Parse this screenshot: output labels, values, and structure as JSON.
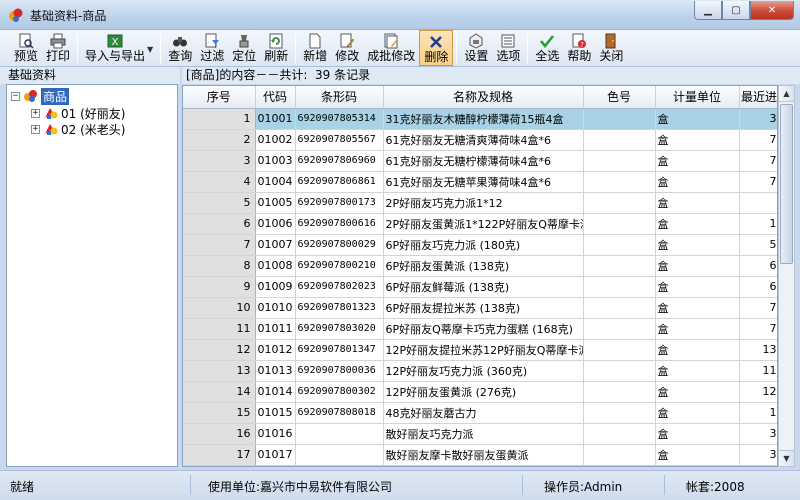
{
  "window": {
    "title": "基础资料-商品",
    "minimize": "0",
    "restore": "1",
    "close": "r"
  },
  "toolbar": {
    "preview": "预览",
    "print": "打印",
    "import_export": "导入与导出",
    "query": "查询",
    "filter": "过滤",
    "locate": "定位",
    "refresh": "刷新",
    "add": "新增",
    "modify": "修改",
    "batch_modify": "成批修改",
    "delete": "删除",
    "settings": "设置",
    "options": "选项",
    "select_all": "全选",
    "help": "帮助",
    "close": "关闭"
  },
  "left_pane": {
    "title": "基础资料",
    "root_toggle": "−",
    "root": "商品",
    "children": [
      {
        "toggle": "+",
        "label": "01 (好丽友)"
      },
      {
        "toggle": "+",
        "label": "02 (米老头)"
      }
    ]
  },
  "grid_info": "[商品]的内容－－共计:  39 条记录",
  "columns": [
    "序号",
    "代码",
    "条形码",
    "名称及规格",
    "色号",
    "计量单位",
    "最近进"
  ],
  "rows": [
    {
      "no": "1",
      "code": "01001",
      "barcode": "6920907805314",
      "name": "31克好丽友木糖醇柠檬薄荷15瓶4盒",
      "color": "",
      "unit": "盒",
      "recent": "3"
    },
    {
      "no": "2",
      "code": "01002",
      "barcode": "6920907805567",
      "name": "61克好丽友无糖清爽薄荷味4盒*6",
      "color": "",
      "unit": "盒",
      "recent": "7"
    },
    {
      "no": "3",
      "code": "01003",
      "barcode": "6920907806960",
      "name": "61克好丽友无糖柠檬薄荷味4盒*6",
      "color": "",
      "unit": "盒",
      "recent": "7"
    },
    {
      "no": "4",
      "code": "01004",
      "barcode": "6920907806861",
      "name": "61克好丽友无糖苹果薄荷味4盒*6",
      "color": "",
      "unit": "盒",
      "recent": "7"
    },
    {
      "no": "5",
      "code": "01005",
      "barcode": "6920907800173",
      "name": "2P好丽友巧克力派1*12",
      "color": "",
      "unit": "盒",
      "recent": ""
    },
    {
      "no": "6",
      "code": "01006",
      "barcode": "6920907800616",
      "name": "2P好丽友蛋黄派1*122P好丽友Q蒂摩卡派",
      "color": "",
      "unit": "盒",
      "recent": "1"
    },
    {
      "no": "7",
      "code": "01007",
      "barcode": "6920907800029",
      "name": "6P好丽友巧克力派 (180克)",
      "color": "",
      "unit": "盒",
      "recent": "5"
    },
    {
      "no": "8",
      "code": "01008",
      "barcode": "6920907800210",
      "name": "6P好丽友蛋黄派 (138克)",
      "color": "",
      "unit": "盒",
      "recent": "6"
    },
    {
      "no": "9",
      "code": "01009",
      "barcode": "6920907802023",
      "name": "6P好丽友鲜莓派 (138克)",
      "color": "",
      "unit": "盒",
      "recent": "6"
    },
    {
      "no": "10",
      "code": "01010",
      "barcode": "6920907801323",
      "name": "6P好丽友提拉米苏 (138克)",
      "color": "",
      "unit": "盒",
      "recent": "7"
    },
    {
      "no": "11",
      "code": "01011",
      "barcode": "6920907803020",
      "name": "6P好丽友Q蒂摩卡巧克力蛋糕 (168克)",
      "color": "",
      "unit": "盒",
      "recent": "7"
    },
    {
      "no": "12",
      "code": "01012",
      "barcode": "6920907801347",
      "name": "12P好丽友提拉米苏12P好丽友Q蒂摩卡派",
      "color": "",
      "unit": "盒",
      "recent": "13"
    },
    {
      "no": "13",
      "code": "01013",
      "barcode": "6920907800036",
      "name": "12P好丽友巧克力派 (360克)",
      "color": "",
      "unit": "盒",
      "recent": "11"
    },
    {
      "no": "14",
      "code": "01014",
      "barcode": "6920907800302",
      "name": "12P好丽友蛋黄派 (276克)",
      "color": "",
      "unit": "盒",
      "recent": "12"
    },
    {
      "no": "15",
      "code": "01015",
      "barcode": "6920907808018",
      "name": "48克好丽友蘑古力",
      "color": "",
      "unit": "盒",
      "recent": "1"
    },
    {
      "no": "16",
      "code": "01016",
      "barcode": "",
      "name": "散好丽友巧克力派",
      "color": "",
      "unit": "盒",
      "recent": "3"
    },
    {
      "no": "17",
      "code": "01017",
      "barcode": "",
      "name": "散好丽友摩卡散好丽友蛋黄派",
      "color": "",
      "unit": "盒",
      "recent": "3"
    }
  ],
  "statusbar": {
    "status": "就绪",
    "company": "使用单位:嘉兴市中易软件有限公司",
    "operator": "操作员:Admin",
    "account": "帐套:2008"
  },
  "colors": {
    "selected_row": "#a8d3e6",
    "active_button": "#f8cf86",
    "tree_selection": "#3168c0"
  }
}
